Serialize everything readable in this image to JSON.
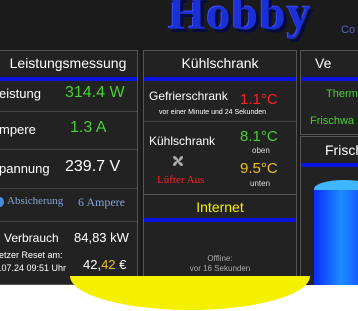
{
  "header": {
    "logo_text": "Hobby",
    "logo_sub": "Co"
  },
  "leistung": {
    "title": "Leistungsmessung",
    "rows": [
      {
        "label": "eistung",
        "value": "314.4 W"
      },
      {
        "label": "mpere",
        "value": "1.3 A"
      },
      {
        "label": "pannung",
        "value": "239.7 V"
      }
    ],
    "absicherung_label": "Absicherung",
    "absicherung_value": "6 Ampere",
    "verbrauch_label": "Verbrauch",
    "verbrauch_value": "84,83 kW",
    "reset_label": "etzer Reset am:",
    "reset_date": ".07.24 09:51 Uhr",
    "cost_main": "42,",
    "cost_highlight": "42",
    "cost_currency": " €"
  },
  "kuehlschrank": {
    "title": "Kühlschrank",
    "gefrier_label": "Gefrierschrank",
    "gefrier_value": "1.1°C",
    "gefrier_note": "vor einer Minute und 24 Sekunden",
    "kuehl_label": "Kühlschrank",
    "oben_value": "8.1°C",
    "oben_label": "oben",
    "unten_value": "9.5°C",
    "unten_label": "unten",
    "fan_icon": "fan-icon",
    "luefter_status": "Lüfter Aus"
  },
  "internet": {
    "title": "Internet",
    "status_line1": "Offline:",
    "status_line2": "vor 16 Sekunden"
  },
  "right": {
    "title": "Ve",
    "item1": "Therm",
    "item2": "Frischwa",
    "frisch_title": "Frisch"
  },
  "colors": {
    "accent_blue": "#0a14e0",
    "green": "#48d030",
    "red": "#ff2020",
    "yellow": "#f0c020"
  }
}
